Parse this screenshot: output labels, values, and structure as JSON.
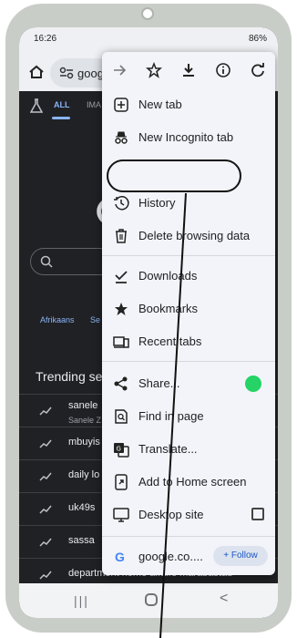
{
  "status_bar": {
    "time": "16:26",
    "battery": "86%"
  },
  "url_bar": {
    "text": "goog"
  },
  "page": {
    "tabs": [
      "ALL",
      "IMA"
    ],
    "languages": [
      "Afrikaans",
      "Se"
    ],
    "trending_title": "Trending se",
    "trending": [
      {
        "title": "sanele",
        "subtitle": "Sanele Z"
      },
      {
        "title": "mbuyis",
        "subtitle": ""
      },
      {
        "title": "daily lo",
        "subtitle": ""
      },
      {
        "title": "uk49s",
        "subtitle": ""
      },
      {
        "title": "sassa",
        "subtitle": ""
      },
      {
        "title": "department home affairs marabastad",
        "subtitle": ""
      }
    ]
  },
  "menu": {
    "toolbar_icons": [
      "forward-icon",
      "star-icon",
      "download-icon",
      "info-icon",
      "refresh-icon"
    ],
    "items": [
      {
        "label": "New tab",
        "icon": "plus-box-icon"
      },
      {
        "label": "New Incognito tab",
        "icon": "incognito-icon"
      },
      {
        "label": "History",
        "icon": "history-icon"
      },
      {
        "label": "Delete browsing data",
        "icon": "trash-icon"
      },
      {
        "label": "Downloads",
        "icon": "download-check-icon"
      },
      {
        "label": "Bookmarks",
        "icon": "star-icon"
      },
      {
        "label": "Recent tabs",
        "icon": "devices-icon"
      },
      {
        "label": "Share...",
        "icon": "share-icon"
      },
      {
        "label": "Find in page",
        "icon": "find-icon"
      },
      {
        "label": "Translate...",
        "icon": "translate-icon"
      },
      {
        "label": "Add to Home screen",
        "icon": "add-home-icon"
      },
      {
        "label": "Desktop site",
        "icon": "desktop-icon"
      }
    ],
    "site_label": "google.co....",
    "follow_label": "+ Follow"
  },
  "annotation": {
    "highlighted_item": "History"
  },
  "colors": {
    "accent": "#8ab4f8",
    "whatsapp": "#25d366",
    "menu_bg": "#f3f4f9"
  }
}
